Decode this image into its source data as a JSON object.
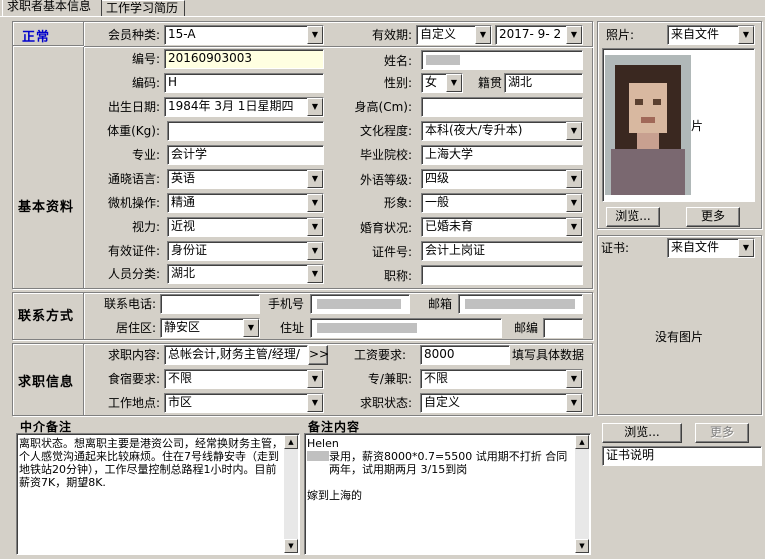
{
  "tabs": [
    {
      "label": "求职者基本信息"
    },
    {
      "label": "工作学习简历"
    }
  ],
  "status": {
    "label": "正常",
    "color": "#0000cc"
  },
  "sections": {
    "basic": "基本资料",
    "contact": "联系方式",
    "job": "求职信息",
    "agent_notes": "中介备注",
    "notes": "备注内容"
  },
  "fields": {
    "member_type": {
      "label": "会员种类:",
      "value": "15-A"
    },
    "validity": {
      "label": "有效期:",
      "mode": "自定义",
      "date": "2017- 9- 2"
    },
    "number": {
      "label": "编号:",
      "value": "20160903003"
    },
    "name": {
      "label": "姓名:",
      "value": ""
    },
    "code": {
      "label": "编码:",
      "value": "H"
    },
    "gender": {
      "label": "性别:",
      "value": "女"
    },
    "native": {
      "label": "籍贯",
      "value": "湖北"
    },
    "birthday": {
      "label": "出生日期:",
      "value": "1984年 3月 1日星期四"
    },
    "height": {
      "label": "身高(Cm):",
      "value": ""
    },
    "weight": {
      "label": "体重(Kg):",
      "value": ""
    },
    "education": {
      "label": "文化程度:",
      "value": "本科(夜大/专升本)"
    },
    "major": {
      "label": "专业:",
      "value": "会计学"
    },
    "school": {
      "label": "毕业院校:",
      "value": "上海大学"
    },
    "language": {
      "label": "通晓语言:",
      "value": "英语"
    },
    "foreign_level": {
      "label": "外语等级:",
      "value": "四级"
    },
    "computer": {
      "label": "微机操作:",
      "value": "精通"
    },
    "image": {
      "label": "形象:",
      "value": "一般"
    },
    "vision": {
      "label": "视力:",
      "value": "近视"
    },
    "marital": {
      "label": "婚育状况:",
      "value": "已婚未育"
    },
    "id_type": {
      "label": "有效证件:",
      "value": "身份证"
    },
    "cert_no": {
      "label": "证件号:",
      "value": "会计上岗证"
    },
    "person_type": {
      "label": "人员分类:",
      "value": "湖北"
    },
    "title": {
      "label": "职称:",
      "value": ""
    },
    "phone": {
      "label": "联系电话:",
      "value": ""
    },
    "mobile": {
      "label": "手机号",
      "value": ""
    },
    "email": {
      "label": "邮箱",
      "value": ""
    },
    "district": {
      "label": "居住区:",
      "value": "静安区"
    },
    "address": {
      "label": "住址",
      "value": ""
    },
    "postcode": {
      "label": "邮编",
      "value": ""
    },
    "job_content": {
      "label": "求职内容:",
      "value": "总帐会计,财务主管/经理/",
      "more": ">>"
    },
    "salary": {
      "label": "工资要求:",
      "value": "8000",
      "hint": "填写具体数据"
    },
    "board": {
      "label": "食宿要求:",
      "value": "不限"
    },
    "fulltime": {
      "label": "专/兼职:",
      "value": "不限"
    },
    "location": {
      "label": "工作地点:",
      "value": "市区"
    },
    "job_status": {
      "label": "求职状态:",
      "value": "自定义"
    }
  },
  "agent_notes_text": "离职状态。想离职主要是港资公司，经常换财务主管，个人感觉沟通起来比较麻烦。住在7号线静安寺（走到地铁站20分钟），工作尽量控制总路程1小时内。目前薪资7K，期望8K.",
  "notes_text": {
    "line1": "Helen",
    "line2": "录用，薪资8000*0.7=5500 试用期不打折 合同两年，试用期两月  3/15到岗",
    "line3": "嫁到上海的"
  },
  "photo": {
    "label": "照片:",
    "source": "来自文件",
    "partial_text": "片",
    "browse": "浏览...",
    "more": "更多"
  },
  "certificate": {
    "label": "证书:",
    "source": "来自文件",
    "empty_text": "没有图片",
    "browse": "浏览...",
    "more": "更多",
    "desc": "证书说明"
  }
}
